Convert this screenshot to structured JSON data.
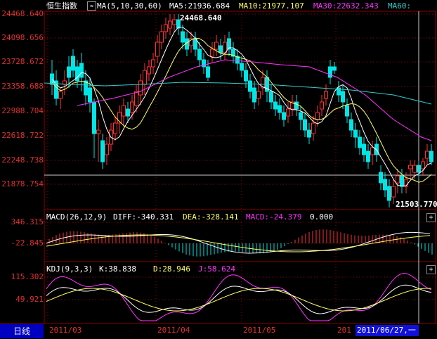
{
  "header": {
    "index_name": "恒生指数",
    "ma_label": "MA(5,10,30,60)",
    "ma5": "MA5:21936.684",
    "ma10": "MA10:21977.107",
    "ma30": "MA30:22632.343",
    "ma60": "MA60:"
  },
  "price_axis": [
    "24468.640",
    "24098.656",
    "23728.672",
    "23358.688",
    "22988.704",
    "22618.722",
    "22248.738",
    "21878.754"
  ],
  "price_labels": {
    "high": "24468.640",
    "low": "21503.770"
  },
  "macd": {
    "title": "MACD(26,12,9)",
    "diff": "DIFF:-340.331",
    "dea": "DEA:-328.141",
    "macd": "MACD:-24.379",
    "zero": "0.000",
    "axis": [
      "346.315",
      "-22.845"
    ]
  },
  "kdj": {
    "title": "KDJ(9,3,3)",
    "k": "K:38.838",
    "d": "D:28.946",
    "j": "J:58.624",
    "axis": [
      "115.302",
      "49.921"
    ]
  },
  "footer": {
    "period_tab": "日线",
    "months": [
      "2011/03",
      "2011/04",
      "2011/05",
      "201"
    ],
    "current_date": "2011/06/27,一"
  },
  "colors": {
    "up": "#ff3333",
    "down": "#00e5e5",
    "ma5": "#ffffff",
    "ma10": "#ffff66",
    "ma30": "#ff33ff",
    "ma60": "#33cccc",
    "axis_text": "#e03030",
    "grid": "#8b0000"
  },
  "icons": {
    "settings_toggle": "ma-toggle-icon",
    "expand": "plus-icon"
  }
}
